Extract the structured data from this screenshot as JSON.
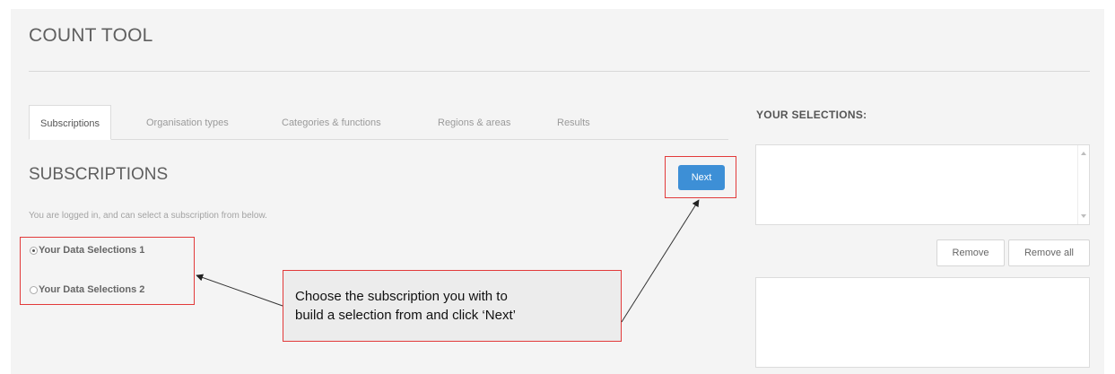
{
  "app": {
    "title": "COUNT TOOL"
  },
  "tabs": [
    {
      "label": "Subscriptions",
      "active": true
    },
    {
      "label": "Organisation types",
      "active": false
    },
    {
      "label": "Categories & functions",
      "active": false
    },
    {
      "label": "Regions & areas",
      "active": false
    },
    {
      "label": "Results",
      "active": false
    }
  ],
  "main": {
    "section_title": "SUBSCRIPTIONS",
    "next_label": "Next",
    "intro": "You are logged in, and can select a subscription from below.",
    "options": [
      {
        "label": "Your Data Selections 1",
        "selected": true
      },
      {
        "label": "Your Data Selections 2",
        "selected": false
      }
    ]
  },
  "callout": {
    "line1": "Choose the subscription you with to",
    "line2": "build a selection from and click ‘Next’"
  },
  "selections": {
    "title": "YOUR SELECTIONS:",
    "remove_label": "Remove",
    "remove_all_label": "Remove all"
  },
  "colors": {
    "accent": "#3d8fd6",
    "highlight": "#e23a3a",
    "panel_bg": "#f4f4f4"
  }
}
